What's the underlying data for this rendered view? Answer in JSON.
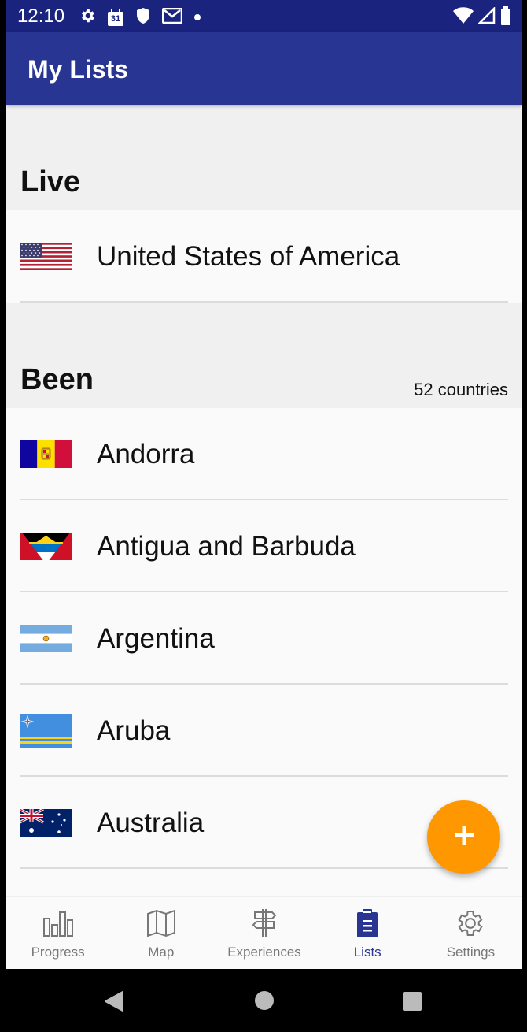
{
  "status_bar": {
    "time": "12:10",
    "calendar_day": "31"
  },
  "app_bar": {
    "title": "My Lists"
  },
  "live": {
    "title": "Live",
    "items": [
      {
        "name": "United States of America",
        "flag": "us-flag-icon"
      }
    ]
  },
  "been": {
    "title": "Been",
    "count_text": "52 countries",
    "items": [
      {
        "name": "Andorra",
        "flag": "andorra-flag-icon"
      },
      {
        "name": "Antigua and Barbuda",
        "flag": "antigua-flag-icon"
      },
      {
        "name": "Argentina",
        "flag": "argentina-flag-icon"
      },
      {
        "name": "Aruba",
        "flag": "aruba-flag-icon"
      },
      {
        "name": "Australia",
        "flag": "australia-flag-icon"
      }
    ]
  },
  "fab": {
    "icon": "plus-icon"
  },
  "bottom_nav": {
    "items": [
      {
        "label": "Progress",
        "icon": "bar-chart-icon",
        "active": false
      },
      {
        "label": "Map",
        "icon": "map-icon",
        "active": false
      },
      {
        "label": "Experiences",
        "icon": "signpost-icon",
        "active": false
      },
      {
        "label": "Lists",
        "icon": "clipboard-list-icon",
        "active": true
      },
      {
        "label": "Settings",
        "icon": "gear-icon",
        "active": false
      }
    ]
  },
  "colors": {
    "status_bar": "#1a237e",
    "app_bar": "#283593",
    "accent": "#ff9800",
    "active_nav": "#283593"
  }
}
